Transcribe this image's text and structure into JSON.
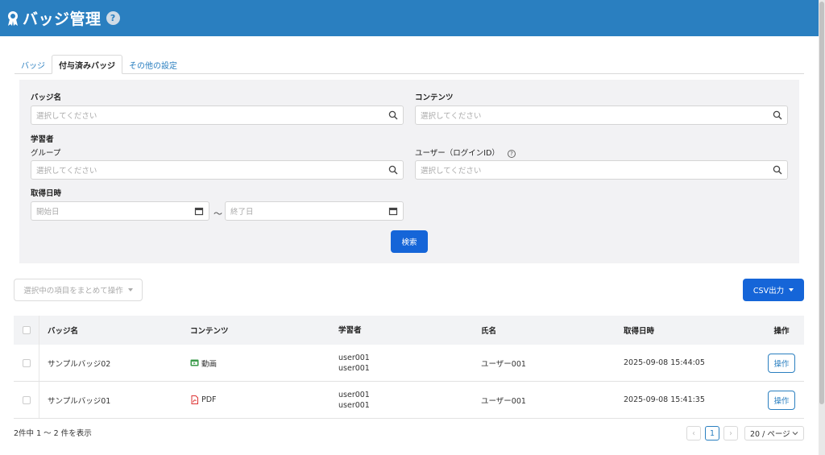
{
  "header": {
    "title": "バッジ管理",
    "help": "?"
  },
  "tabs": [
    {
      "label": "バッジ",
      "active": false
    },
    {
      "label": "付与済みバッジ",
      "active": true
    },
    {
      "label": "その他の設定",
      "active": false
    }
  ],
  "filters": {
    "badge_label": "バッジ名",
    "badge_placeholder": "選択してください",
    "content_label": "コンテンツ",
    "content_placeholder": "選択してください",
    "learner_label": "学習者",
    "group_label": "グループ",
    "group_placeholder": "選択してください",
    "user_label": "ユーザー（ログインID）",
    "user_placeholder": "選択してください",
    "date_label": "取得日時",
    "start_placeholder": "開始日",
    "end_placeholder": "終了日",
    "tilde": "～",
    "search_button": "検索"
  },
  "actions": {
    "bulk_label": "選択中の項目をまとめて操作",
    "csv_label": "CSV出力"
  },
  "table": {
    "headers": [
      "バッジ名",
      "コンテンツ",
      "学習者",
      "氏名",
      "取得日時",
      "操作"
    ],
    "rows": [
      {
        "badge": "サンプルバッジ02",
        "content": "動画",
        "content_icon": "video-icon",
        "learner1": "user001",
        "learner2": "user001",
        "name": "ユーザー001",
        "date": "2025-09-08 15:44:05",
        "op": "操作"
      },
      {
        "badge": "サンプルバッジ01",
        "content": "PDF",
        "content_icon": "pdf-icon",
        "learner1": "user001",
        "learner2": "user001",
        "name": "ユーザー001",
        "date": "2025-09-08 15:41:35",
        "op": "操作"
      }
    ]
  },
  "pagination": {
    "summary": "2件中 1 ～ 2 件を表示",
    "prev": "‹",
    "current": "1",
    "next": "›",
    "page_size": "20 / ページ"
  },
  "colors": {
    "header": "#2a7fc0",
    "primary": "#1565d8",
    "panel": "#f2f2f4"
  }
}
